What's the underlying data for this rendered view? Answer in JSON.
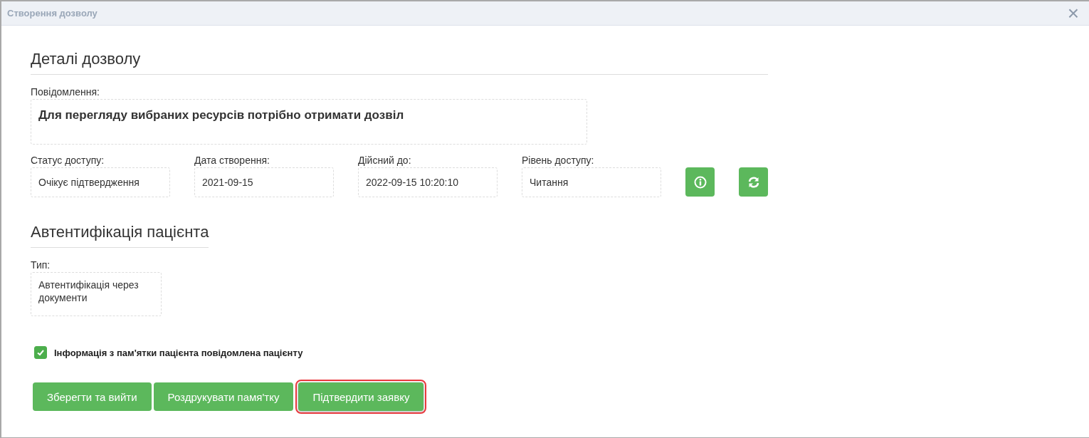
{
  "window": {
    "title": "Створення дозволу",
    "close": "×"
  },
  "details": {
    "heading": "Деталі дозволу",
    "message_label": "Повідомлення:",
    "message": "Для перегляду вибраних ресурсів потрібно отримати дозвіл",
    "fields": [
      {
        "label": "Статус доступу:",
        "value": "Очікує підтвердження"
      },
      {
        "label": "Дата створення:",
        "value": "2021-09-15"
      },
      {
        "label": "Дійсний до:",
        "value": "2022-09-15 10:20:10"
      },
      {
        "label": "Рівень доступу:",
        "value": "Читання"
      }
    ],
    "actions": [
      {
        "kind": "info"
      },
      {
        "kind": "refresh"
      }
    ]
  },
  "authentication": {
    "heading": "Автентифікація пацієнта",
    "type_label": "Тип:",
    "type_value": "Автентифікація через документи"
  },
  "consent": {
    "label": "Інформація з пам'ятки пацієнта повідомлена пацієнту",
    "checked": true
  },
  "buttons": [
    {
      "label": "Зберегти та вийти",
      "highlighted": false
    },
    {
      "label": "Роздрукувати памя'тку",
      "highlighted": false
    },
    {
      "label": "Підтвердити заявку",
      "highlighted": true
    }
  ]
}
